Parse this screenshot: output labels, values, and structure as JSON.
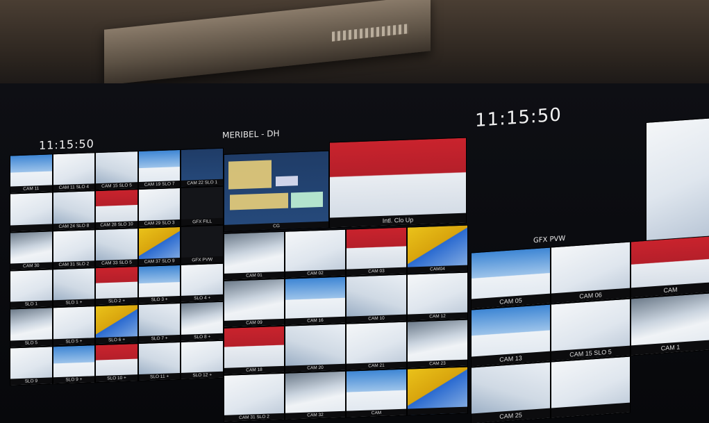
{
  "left_wall": {
    "clock": "11:15:50",
    "tiles": [
      {
        "label": "CAM 11",
        "style": "sky"
      },
      {
        "label": "CAM 11 SLO 4",
        "style": "snow"
      },
      {
        "label": "CAM 15 SLO 5",
        "style": "snow2"
      },
      {
        "label": "CAM 19 SLO 7",
        "style": "sky"
      },
      {
        "label": "CAM 22 SLO 1",
        "style": "gfx"
      },
      {
        "label": "",
        "style": "snow"
      },
      {
        "label": "CAM 24 SLO 8",
        "style": "snow2"
      },
      {
        "label": "CAM 28 SLO 10",
        "style": "redbn"
      },
      {
        "label": "CAM 29 SLO 3",
        "style": "snow"
      },
      {
        "label": "GFX FILL",
        "style": "dark"
      },
      {
        "label": "CAM 30",
        "style": "mtn"
      },
      {
        "label": "CAM 31 SLO 2",
        "style": "snow"
      },
      {
        "label": "CAM 33 SLO 5",
        "style": "snow2"
      },
      {
        "label": "CAM 37 SLO 9",
        "style": "yel"
      },
      {
        "label": "GFX PVW",
        "style": "dark"
      },
      {
        "label": "SLO 1",
        "style": "snow"
      },
      {
        "label": "SLO 1 +",
        "style": "snow2"
      },
      {
        "label": "SLO 2 +",
        "style": "redbn"
      },
      {
        "label": "SLO 3 +",
        "style": "sky"
      },
      {
        "label": "SLO 4 +",
        "style": "snow"
      },
      {
        "label": "SLO 5",
        "style": "mtn"
      },
      {
        "label": "SLO 5 +",
        "style": "snow"
      },
      {
        "label": "SLO 6 +",
        "style": "yel"
      },
      {
        "label": "SLO 7 +",
        "style": "snow2"
      },
      {
        "label": "SLO 8 +",
        "style": "mtn"
      },
      {
        "label": "SLO 9",
        "style": "snow"
      },
      {
        "label": "SLO 9 +",
        "style": "sky"
      },
      {
        "label": "SLO 10 +",
        "style": "redbn"
      },
      {
        "label": "SLO 11 +",
        "style": "snow2"
      },
      {
        "label": "SLO 12 +",
        "style": "snow"
      }
    ]
  },
  "center_wall": {
    "header": "MERIBEL - DH",
    "gfx_label": "CG",
    "program_label": "Intl. Clo Up",
    "tiles": [
      {
        "label": "CAM 01",
        "style": "mtn"
      },
      {
        "label": "CAM 02",
        "style": "snow"
      },
      {
        "label": "CAM 03",
        "style": "redbn"
      },
      {
        "label": "CAM04",
        "style": "yel"
      },
      {
        "label": "CAM 09",
        "style": "mtn"
      },
      {
        "label": "CAM 16",
        "style": "sky"
      },
      {
        "label": "CAM 10",
        "style": "snow2"
      },
      {
        "label": "CAM 12",
        "style": "snow"
      },
      {
        "label": "CAM 18",
        "style": "redbn"
      },
      {
        "label": "CAM 20",
        "style": "snow2"
      },
      {
        "label": "CAM 21",
        "style": "snow"
      },
      {
        "label": "CAM 23",
        "style": "mtn"
      },
      {
        "label": "CAM 31 SLO 2",
        "style": "snow"
      },
      {
        "label": "CAM 32",
        "style": "mtn"
      },
      {
        "label": "CAM",
        "style": "sky"
      },
      {
        "label": "",
        "style": "yel"
      }
    ]
  },
  "right_wall": {
    "clock": "11:15:50",
    "gfx_pvw": "GFX PVW",
    "tiles": [
      {
        "label": "CAM 05",
        "style": "sky"
      },
      {
        "label": "CAM 06",
        "style": "snow"
      },
      {
        "label": "CAM",
        "style": "redbn"
      },
      {
        "label": "CAM 13",
        "style": "sky"
      },
      {
        "label": "CAM 15 SLO 5",
        "style": "snow"
      },
      {
        "label": "CAM 1",
        "style": "mtn"
      },
      {
        "label": "CAM 25",
        "style": "snow2"
      },
      {
        "label": "",
        "style": "snow"
      }
    ]
  }
}
